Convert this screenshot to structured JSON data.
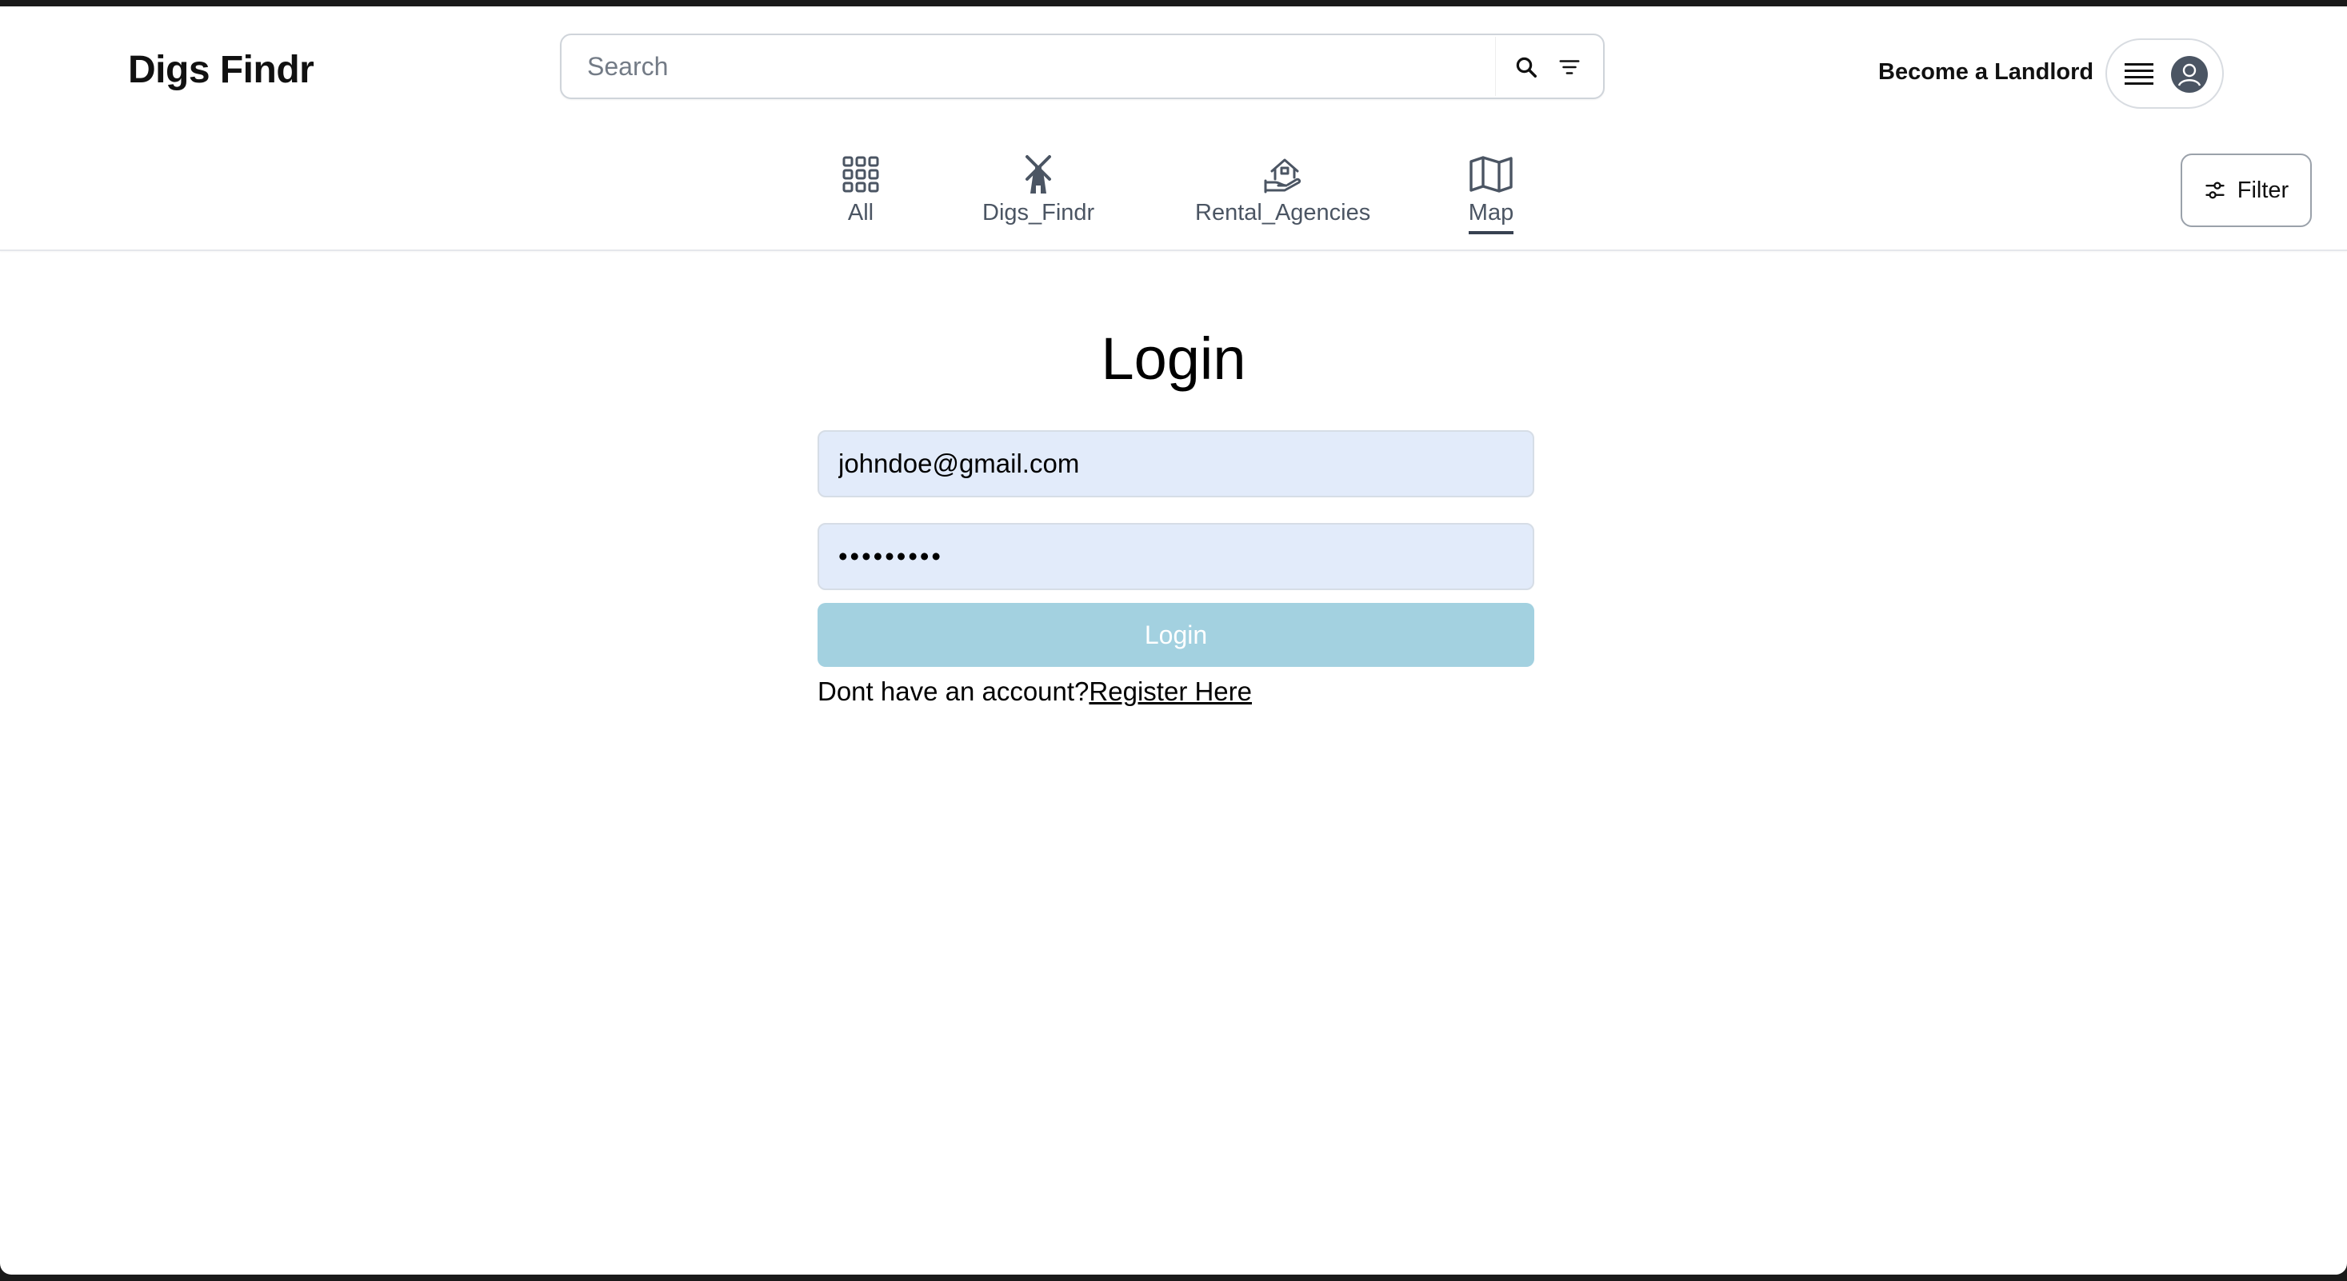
{
  "header": {
    "logo": "Digs Findr",
    "search": {
      "placeholder": "Search",
      "value": ""
    },
    "become_landlord": "Become a Landlord"
  },
  "categories": [
    {
      "label": "All",
      "icon": "grid-icon",
      "active": false
    },
    {
      "label": "Digs_Findr",
      "icon": "windmill-icon",
      "active": false
    },
    {
      "label": "Rental_Agencies",
      "icon": "house-hand-icon",
      "active": false
    },
    {
      "label": "Map",
      "icon": "map-icon",
      "active": true
    }
  ],
  "filter": {
    "label": "Filter"
  },
  "login": {
    "title": "Login",
    "email_value": "johndoe@gmail.com",
    "password_mask": "•••••••••",
    "button_label": "Login",
    "no_account_text": "Dont have an account?",
    "register_link": "Register Here"
  },
  "colors": {
    "input_bg": "#e2ebfa",
    "button_bg": "#a3d1e0",
    "icon_gray": "#4b5563"
  }
}
